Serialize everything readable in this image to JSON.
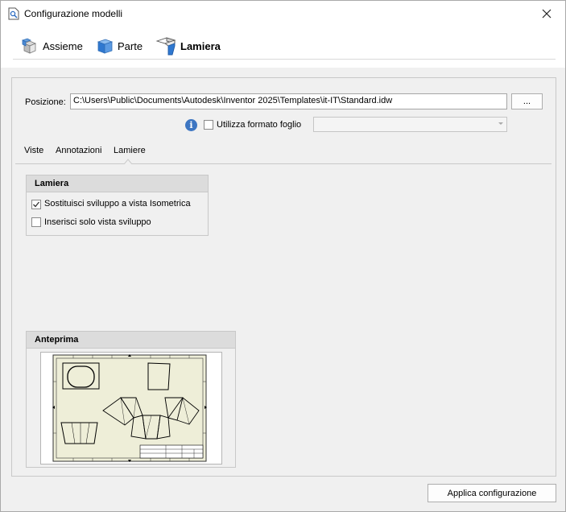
{
  "window": {
    "title": "Configurazione modelli",
    "close_glyph": "✕"
  },
  "top_tabs": [
    {
      "label": "Assieme",
      "icon": "assembly-icon"
    },
    {
      "label": "Parte",
      "icon": "part-icon"
    },
    {
      "label": "Lamiera",
      "icon": "sheet-metal-icon",
      "active": true
    }
  ],
  "position": {
    "label": "Posizione:",
    "value": "C:\\Users\\Public\\Documents\\Autodesk\\Inventor 2025\\Templates\\it-IT\\Standard.idw",
    "browse_label": "..."
  },
  "format_option": {
    "label": "Utilizza formato foglio",
    "checked": false,
    "combo_value": ""
  },
  "sub_tabs": [
    {
      "label": "Viste"
    },
    {
      "label": "Annotazioni"
    },
    {
      "label": "Lamiere",
      "active": true
    }
  ],
  "lamiera_group": {
    "title": "Lamiera",
    "options": [
      {
        "label": "Sostituisci sviluppo a vista Isometrica",
        "checked": true
      },
      {
        "label": "Inserisci solo vista sviluppo",
        "checked": false
      }
    ]
  },
  "preview_group": {
    "title": "Anteprima"
  },
  "apply_label": "Applica configurazione",
  "colors": {
    "accent": "#3d76c2",
    "sheet_bg": "#eeeed8"
  }
}
